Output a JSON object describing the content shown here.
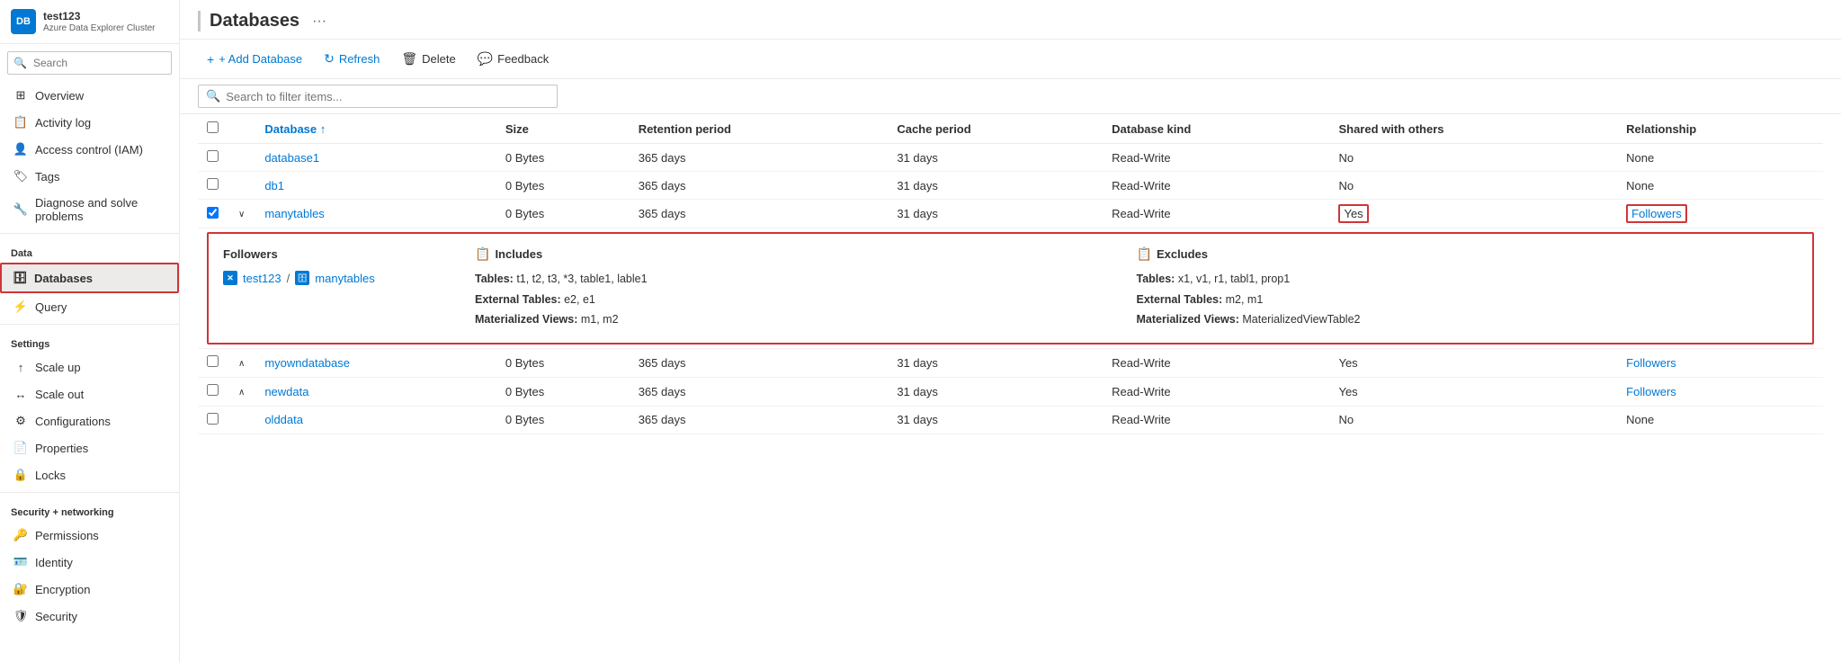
{
  "sidebar": {
    "app_name": "test123",
    "app_subtitle": "Azure Data Explorer Cluster",
    "search_placeholder": "Search",
    "collapse_icon": "«",
    "nav_groups": [
      {
        "items": [
          {
            "id": "overview",
            "label": "Overview",
            "icon": "grid"
          },
          {
            "id": "activity-log",
            "label": "Activity log",
            "icon": "list"
          },
          {
            "id": "access-control",
            "label": "Access control (IAM)",
            "icon": "person-lock"
          },
          {
            "id": "tags",
            "label": "Tags",
            "icon": "tag"
          },
          {
            "id": "diagnose",
            "label": "Diagnose and solve problems",
            "icon": "wrench"
          }
        ]
      },
      {
        "section_label": "Data",
        "items": [
          {
            "id": "databases",
            "label": "Databases",
            "icon": "db",
            "active": true
          },
          {
            "id": "query",
            "label": "Query",
            "icon": "query"
          }
        ]
      },
      {
        "section_label": "Settings",
        "items": [
          {
            "id": "scale-up",
            "label": "Scale up",
            "icon": "scale-up"
          },
          {
            "id": "scale-out",
            "label": "Scale out",
            "icon": "scale-out"
          },
          {
            "id": "configurations",
            "label": "Configurations",
            "icon": "config"
          },
          {
            "id": "properties",
            "label": "Properties",
            "icon": "properties"
          },
          {
            "id": "locks",
            "label": "Locks",
            "icon": "lock"
          }
        ]
      },
      {
        "section_label": "Security + networking",
        "items": [
          {
            "id": "permissions",
            "label": "Permissions",
            "icon": "key"
          },
          {
            "id": "identity",
            "label": "Identity",
            "icon": "identity"
          },
          {
            "id": "encryption",
            "label": "Encryption",
            "icon": "encrypt"
          },
          {
            "id": "security",
            "label": "Security",
            "icon": "shield"
          }
        ]
      }
    ]
  },
  "main": {
    "title": "Databases",
    "toolbar": {
      "add_database": "+ Add Database",
      "refresh": "Refresh",
      "delete": "Delete",
      "feedback": "Feedback"
    },
    "filter_placeholder": "Search to filter items...",
    "table": {
      "columns": [
        "Database ↑",
        "Size",
        "Retention period",
        "Cache period",
        "Database kind",
        "Shared with others",
        "Relationship"
      ],
      "rows": [
        {
          "id": "database1",
          "name": "database1",
          "size": "0 Bytes",
          "retention": "365 days",
          "cache": "31 days",
          "kind": "Read-Write",
          "shared": "No",
          "relationship": "None",
          "expandable": false,
          "expanded": false
        },
        {
          "id": "db1",
          "name": "db1",
          "size": "0 Bytes",
          "retention": "365 days",
          "cache": "31 days",
          "kind": "Read-Write",
          "shared": "No",
          "relationship": "None",
          "expandable": false,
          "expanded": false
        },
        {
          "id": "manytables",
          "name": "manytables",
          "size": "0 Bytes",
          "retention": "365 days",
          "cache": "31 days",
          "kind": "Read-Write",
          "shared": "Yes",
          "relationship": "Followers",
          "expandable": true,
          "expanded": true,
          "follower_panel": {
            "followers_label": "Followers",
            "includes_label": "Includes",
            "excludes_label": "Excludes",
            "source_cluster": "test123",
            "source_db": "manytables",
            "includes": {
              "tables": "t1, t2, t3, *3, table1, lable1",
              "external_tables": "e2, e1",
              "materialized_views": "m1, m2"
            },
            "excludes": {
              "tables": "x1, v1, r1, tabl1, prop1",
              "external_tables": "m2, m1",
              "materialized_views": "MaterializedViewTable2"
            }
          }
        },
        {
          "id": "myowndatabase",
          "name": "myowndatabase",
          "size": "0 Bytes",
          "retention": "365 days",
          "cache": "31 days",
          "kind": "Read-Write",
          "shared": "Yes",
          "relationship": "Followers",
          "expandable": true,
          "expanded": false
        },
        {
          "id": "newdata",
          "name": "newdata",
          "size": "0 Bytes",
          "retention": "365 days",
          "cache": "31 days",
          "kind": "Read-Write",
          "shared": "Yes",
          "relationship": "Followers",
          "expandable": true,
          "expanded": false
        },
        {
          "id": "olddata",
          "name": "olddata",
          "size": "0 Bytes",
          "retention": "365 days",
          "cache": "31 days",
          "kind": "Read-Write",
          "shared": "No",
          "relationship": "None",
          "expandable": false,
          "expanded": false
        }
      ]
    }
  }
}
